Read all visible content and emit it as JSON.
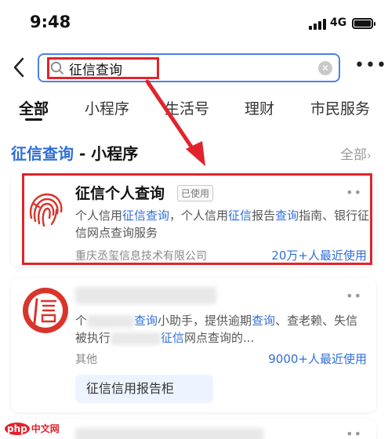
{
  "status_bar": {
    "time": "9:48",
    "network": "4G"
  },
  "search": {
    "query": "征信查询"
  },
  "tabs": [
    {
      "label": "全部"
    },
    {
      "label": "小程序"
    },
    {
      "label": "生活号"
    },
    {
      "label": "理财"
    },
    {
      "label": "市民服务"
    }
  ],
  "section": {
    "title_highlight": "征信查询",
    "title_rest": " - 小程序",
    "all_label": "全部"
  },
  "results": [
    {
      "name": "征信个人查询",
      "badge": "已使用",
      "desc_parts": [
        "个人信用",
        "征信查询",
        "，个人信用",
        "征信",
        "报告",
        "查询",
        "指南、银行征信网点查询服务"
      ],
      "company": "重庆丞玺信息技术有限公司",
      "users": "20万+人最近使用"
    },
    {
      "desc_line1_parts": [
        "个",
        "查询",
        "小助手，提供逾期",
        "查询",
        "、查老赖、失信"
      ],
      "desc_line2_parts": [
        "被执行",
        "征信",
        "网点查询的..."
      ],
      "company": "其他",
      "users": "9000+人最近使用",
      "sub_button": "征信信用报告柜"
    }
  ],
  "watermark": {
    "part1": "php",
    "part2": "中文网"
  },
  "colors": {
    "accent": "#2f6fd8",
    "annotation": "#e3232b",
    "search_border": "#4a82e5"
  }
}
